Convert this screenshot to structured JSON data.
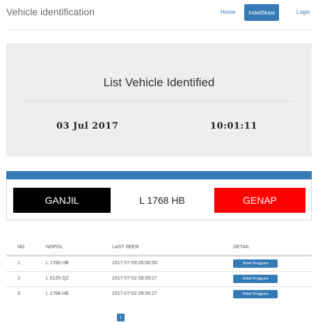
{
  "navbar": {
    "brand": "Vehicle identification",
    "links": [
      "Home",
      "Indetifikasi",
      "Login"
    ],
    "active": "Indetifikasi"
  },
  "jumbotron": {
    "title": "List Vehicle Identified",
    "date": "03 Jul 2017",
    "time": "10:01:11"
  },
  "identify": {
    "left_label": "GANJIL",
    "plate": "L 1768 HB",
    "right_label": "GENAP",
    "colors": {
      "ganjil": "#000000",
      "genap": "#ff0000",
      "header": "#337ab7"
    }
  },
  "table": {
    "headers": [
      "NO",
      "NOPOL",
      "LAST SEEN",
      "DETAIL"
    ],
    "rows": [
      {
        "no": "1",
        "nopol": "L 1768 HB",
        "last_seen": "2017-07-03 05:00:50",
        "detail": "Detail Pengguna"
      },
      {
        "no": "2",
        "nopol": "L 6125 QZ",
        "last_seen": "2017-07-02 09:59:27",
        "detail": "Detail Pengguna"
      },
      {
        "no": "3",
        "nopol": "L 1768 HB",
        "last_seen": "2017-07-02 09:56:27",
        "detail": "Detail Pengguna"
      }
    ]
  },
  "pagination": {
    "current": "1"
  }
}
